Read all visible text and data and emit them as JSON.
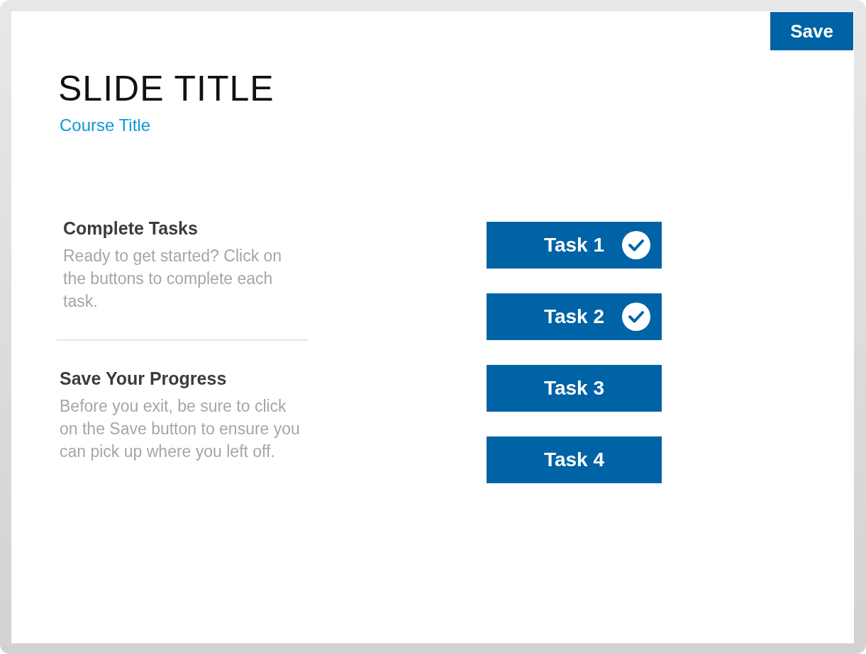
{
  "save_button": {
    "label": "Save"
  },
  "slide": {
    "title": "SLIDE TITLE",
    "course_title": "Course Title"
  },
  "sections": [
    {
      "heading": "Complete Tasks",
      "body": "Ready to get started? Click on the buttons to complete each task."
    },
    {
      "heading": "Save Your Progress",
      "body": "Before you exit, be sure to click on the Save button to ensure you can pick up where you left off."
    }
  ],
  "tasks": [
    {
      "label": "Task 1",
      "completed": true
    },
    {
      "label": "Task 2",
      "completed": true
    },
    {
      "label": "Task 3",
      "completed": false
    },
    {
      "label": "Task 4",
      "completed": false
    }
  ]
}
